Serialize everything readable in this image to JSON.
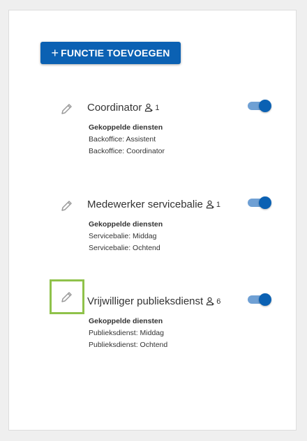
{
  "add_button": {
    "label": "FUNCTIE TOEVOEGEN",
    "icon": "plus-icon"
  },
  "roles": [
    {
      "title": "Coordinator",
      "user_count": "1",
      "details_heading": "Gekoppelde diensten",
      "services": [
        "Backoffice: Assistent",
        "Backoffice: Coordinator"
      ],
      "active": true,
      "edit_focused": false
    },
    {
      "title": "Medewerker servicebalie",
      "user_count": "1",
      "details_heading": "Gekoppelde diensten",
      "services": [
        "Servicebalie: Middag",
        "Servicebalie: Ochtend"
      ],
      "active": true,
      "edit_focused": false
    },
    {
      "title": "Vrijwilliger publieksdienst",
      "user_count": "6",
      "details_heading": "Gekoppelde diensten",
      "services": [
        "Publieksdienst: Middag",
        "Publieksdienst: Ochtend"
      ],
      "active": true,
      "edit_focused": true
    }
  ],
  "colors": {
    "primary": "#0b61b3",
    "toggle_track": "#6fa0d4",
    "focus": "#8fc24a"
  }
}
